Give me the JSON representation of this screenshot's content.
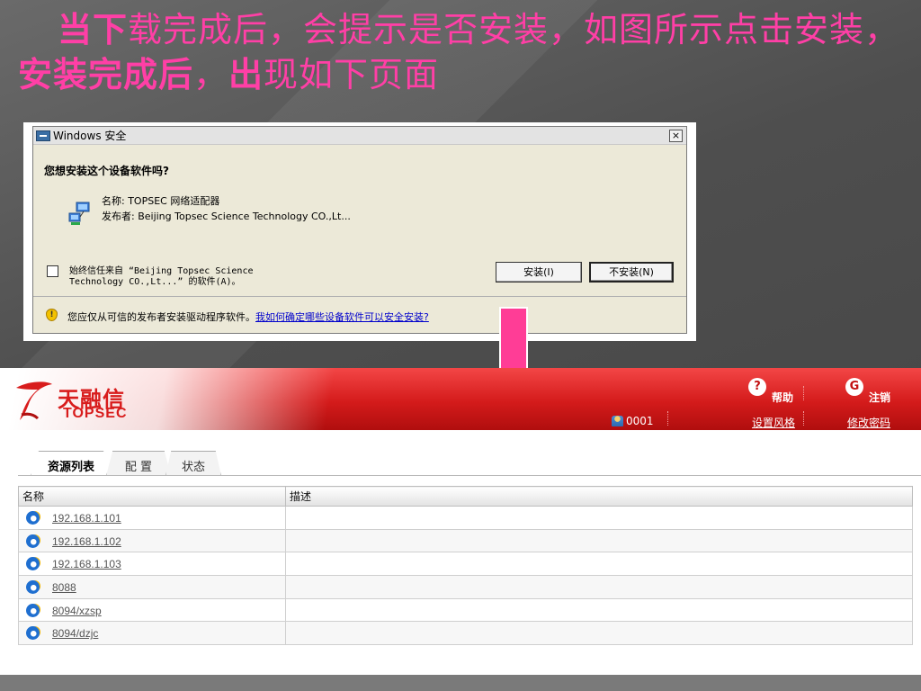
{
  "slide": {
    "title_part1": "当下",
    "title_part2": "载完成后，会提示是否安装，如图所示点击安装，",
    "title_part3": "安装完成后",
    "title_part4": "，",
    "title_part5": "出",
    "title_part6": "现如下页面",
    "title_color": "#ff3fa6"
  },
  "dialog": {
    "window_title": "Windows 安全",
    "question": "您想安装这个设备软件吗?",
    "device_name": "名称: TOPSEC 网络适配器",
    "publisher": "发布者: Beijing Topsec Science Technology CO.,Lt...",
    "trust_checkbox_line1": "始终信任来自 “Beijing Topsec Science",
    "trust_checkbox_line2": "Technology CO.,Lt...” 的软件(A)。",
    "trust_checked": false,
    "install_button": "安装(I)",
    "dont_install_button": "不安装(N)",
    "warning_text": "您应仅从可信的发布者安装驱动程序软件。",
    "warning_link": "我如何确定哪些设备软件可以安全安装?",
    "close_glyph": "×"
  },
  "arrow": {
    "color": "#ff3d96",
    "icon": "down-arrow"
  },
  "app": {
    "logo_cn": "天融信",
    "logo_en": "TOPSEC",
    "user": "0001",
    "help_label": "帮助",
    "logout_label": "注销",
    "style_label": "设置风格",
    "password_label": "修改密码",
    "help_glyph": "?",
    "logout_glyph": "G",
    "tabs": [
      {
        "label": "资源列表",
        "active": true
      },
      {
        "label": "配 置",
        "active": false
      },
      {
        "label": "状态",
        "active": false
      }
    ],
    "table": {
      "headers": [
        "名称",
        "描述"
      ],
      "rows": [
        {
          "name": "192.168.1.101",
          "desc": ""
        },
        {
          "name": "192.168.1.102",
          "desc": ""
        },
        {
          "name": "192.168.1.103",
          "desc": ""
        },
        {
          "name": "8088",
          "desc": ""
        },
        {
          "name": "8094/xzsp",
          "desc": ""
        },
        {
          "name": "8094/dzjc",
          "desc": ""
        }
      ]
    }
  }
}
